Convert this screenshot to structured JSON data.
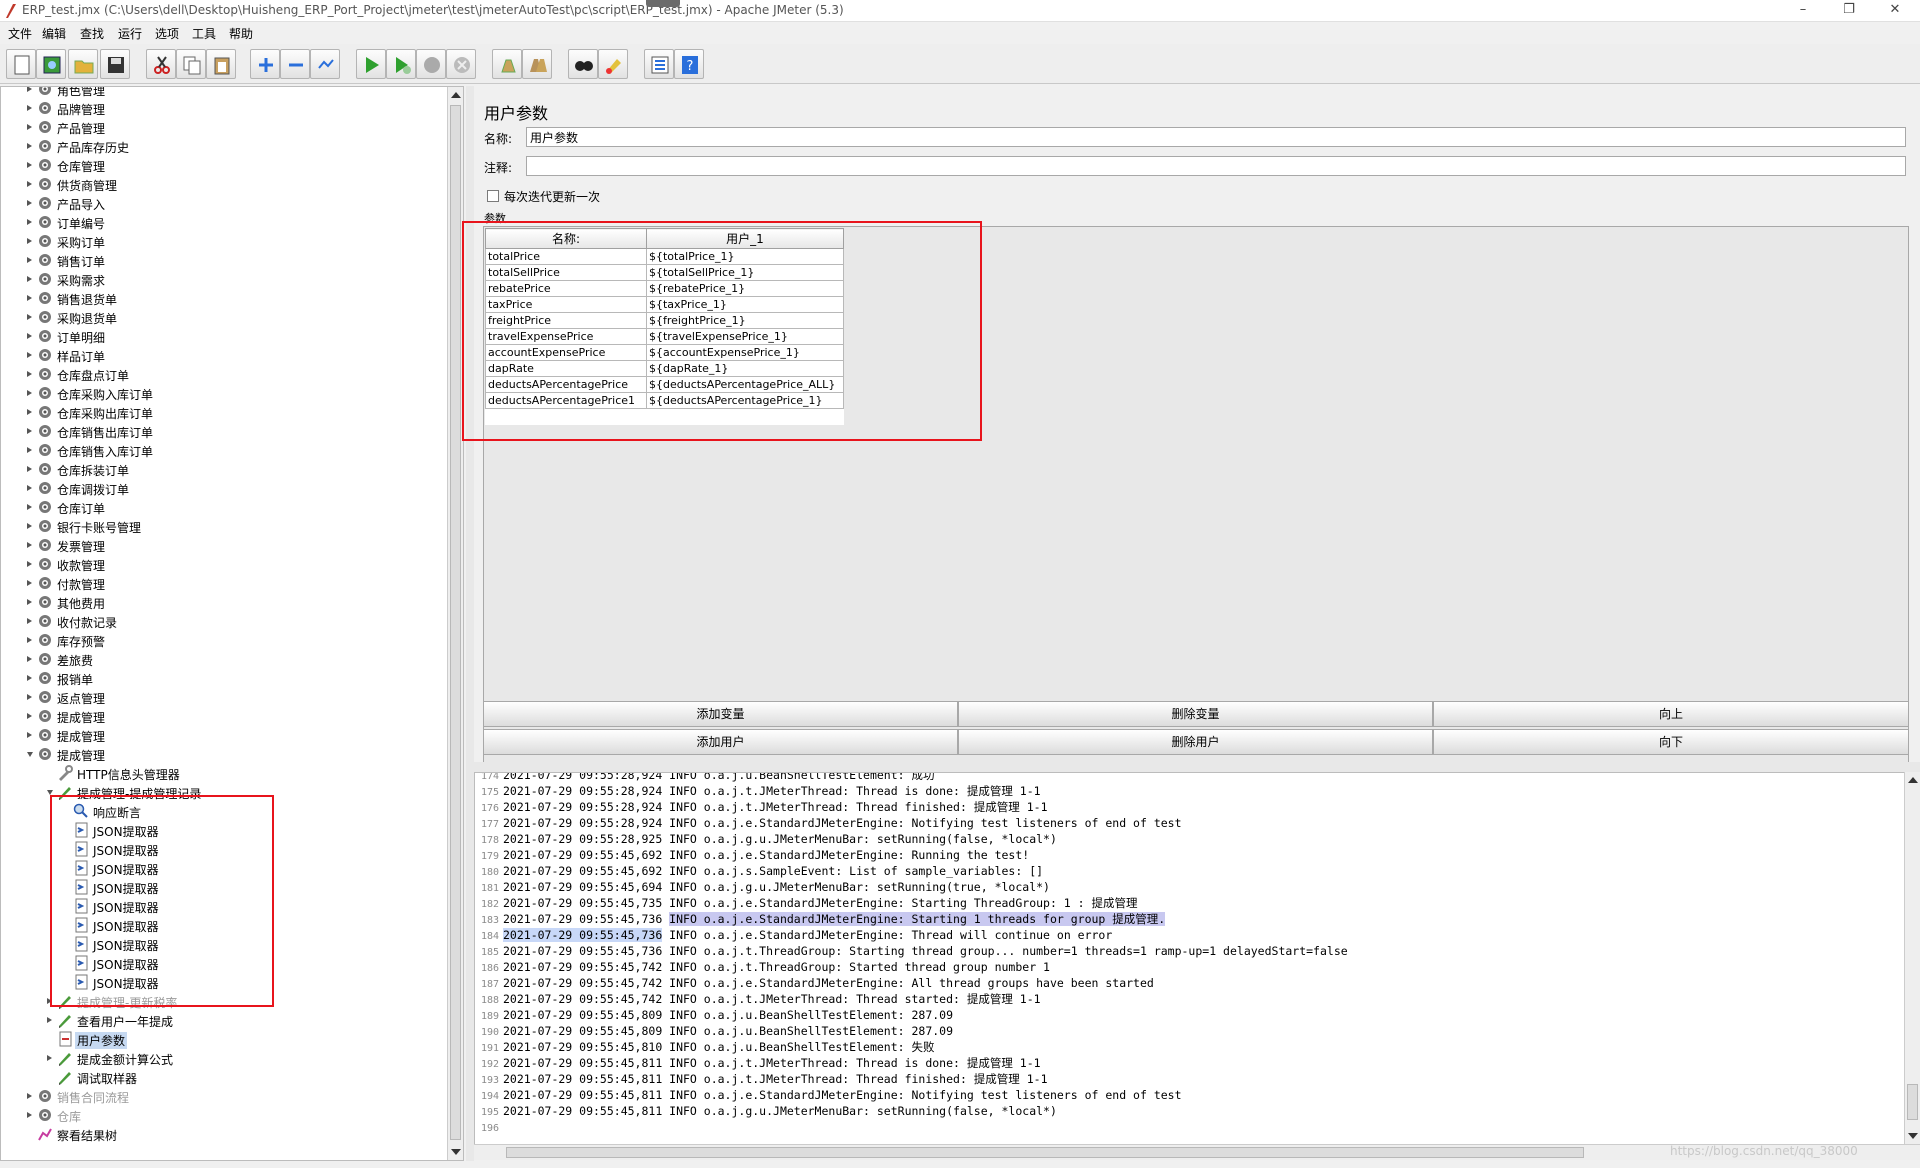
{
  "window": {
    "title": "ERP_test.jmx (C:\\Users\\dell\\Desktop\\Huisheng_ERP_Port_Project\\jmeter\\test\\jmeterAutoTest\\pc\\script\\ERP_test.jmx) - Apache JMeter (5.3)",
    "minimize": "–",
    "maximize": "❐",
    "close": "✕"
  },
  "menu": [
    "文件",
    "编辑",
    "查找",
    "运行",
    "选项",
    "工具",
    "帮助"
  ],
  "toolbar": [
    {
      "name": "new-icon"
    },
    {
      "name": "templates-icon"
    },
    {
      "name": "open-icon"
    },
    {
      "name": "save-icon"
    },
    {
      "name": "cut-icon"
    },
    {
      "name": "copy-icon"
    },
    {
      "name": "paste-icon"
    },
    {
      "name": "expand-icon"
    },
    {
      "name": "collapse-icon"
    },
    {
      "name": "toggle-icon"
    },
    {
      "name": "start-icon"
    },
    {
      "name": "start-no-pause-icon"
    },
    {
      "name": "stop-icon"
    },
    {
      "name": "shutdown-icon"
    },
    {
      "name": "clear-icon"
    },
    {
      "name": "clear-all-icon"
    },
    {
      "name": "search-icon"
    },
    {
      "name": "reset-search-icon"
    },
    {
      "name": "function-helper-icon"
    },
    {
      "name": "help-icon"
    }
  ],
  "tree": [
    {
      "label": "角色管理",
      "level": 1,
      "icon": "gear",
      "toggle": "closed"
    },
    {
      "label": "品牌管理",
      "level": 1,
      "icon": "gear",
      "toggle": "closed"
    },
    {
      "label": "产品管理",
      "level": 1,
      "icon": "gear",
      "toggle": "closed"
    },
    {
      "label": "产品库存历史",
      "level": 1,
      "icon": "gear",
      "toggle": "closed"
    },
    {
      "label": "仓库管理",
      "level": 1,
      "icon": "gear",
      "toggle": "closed"
    },
    {
      "label": "供货商管理",
      "level": 1,
      "icon": "gear",
      "toggle": "closed"
    },
    {
      "label": "产品导入",
      "level": 1,
      "icon": "gear",
      "toggle": "closed"
    },
    {
      "label": "订单编号",
      "level": 1,
      "icon": "gear",
      "toggle": "closed"
    },
    {
      "label": "采购订单",
      "level": 1,
      "icon": "gear",
      "toggle": "closed"
    },
    {
      "label": "销售订单",
      "level": 1,
      "icon": "gear",
      "toggle": "closed"
    },
    {
      "label": "采购需求",
      "level": 1,
      "icon": "gear",
      "toggle": "closed"
    },
    {
      "label": "销售退货单",
      "level": 1,
      "icon": "gear",
      "toggle": "closed"
    },
    {
      "label": "采购退货单",
      "level": 1,
      "icon": "gear",
      "toggle": "closed"
    },
    {
      "label": "订单明细",
      "level": 1,
      "icon": "gear",
      "toggle": "closed"
    },
    {
      "label": "样品订单",
      "level": 1,
      "icon": "gear",
      "toggle": "closed"
    },
    {
      "label": "仓库盘点订单",
      "level": 1,
      "icon": "gear",
      "toggle": "closed"
    },
    {
      "label": "仓库采购入库订单",
      "level": 1,
      "icon": "gear",
      "toggle": "closed"
    },
    {
      "label": "仓库采购出库订单",
      "level": 1,
      "icon": "gear",
      "toggle": "closed"
    },
    {
      "label": "仓库销售出库订单",
      "level": 1,
      "icon": "gear",
      "toggle": "closed"
    },
    {
      "label": "仓库销售入库订单",
      "level": 1,
      "icon": "gear",
      "toggle": "closed"
    },
    {
      "label": "仓库拆装订单",
      "level": 1,
      "icon": "gear",
      "toggle": "closed"
    },
    {
      "label": "仓库调拨订单",
      "level": 1,
      "icon": "gear",
      "toggle": "closed"
    },
    {
      "label": "仓库订单",
      "level": 1,
      "icon": "gear",
      "toggle": "closed"
    },
    {
      "label": "银行卡账号管理",
      "level": 1,
      "icon": "gear",
      "toggle": "closed"
    },
    {
      "label": "发票管理",
      "level": 1,
      "icon": "gear",
      "toggle": "closed"
    },
    {
      "label": "收款管理",
      "level": 1,
      "icon": "gear",
      "toggle": "closed"
    },
    {
      "label": "付款管理",
      "level": 1,
      "icon": "gear",
      "toggle": "closed"
    },
    {
      "label": "其他费用",
      "level": 1,
      "icon": "gear",
      "toggle": "closed"
    },
    {
      "label": "收付款记录",
      "level": 1,
      "icon": "gear",
      "toggle": "closed"
    },
    {
      "label": "库存预警",
      "level": 1,
      "icon": "gear",
      "toggle": "closed"
    },
    {
      "label": "差旅费",
      "level": 1,
      "icon": "gear",
      "toggle": "closed"
    },
    {
      "label": "报销单",
      "level": 1,
      "icon": "gear",
      "toggle": "closed"
    },
    {
      "label": "返点管理",
      "level": 1,
      "icon": "gear",
      "toggle": "closed"
    },
    {
      "label": "提成管理",
      "level": 1,
      "icon": "gear",
      "toggle": "closed"
    },
    {
      "label": "提成管理",
      "level": 1,
      "icon": "gear",
      "toggle": "closed"
    },
    {
      "label": "提成管理",
      "level": 1,
      "icon": "gear",
      "toggle": "open"
    },
    {
      "label": "HTTP信息头管理器",
      "level": 2,
      "icon": "wrench",
      "toggle": "none"
    },
    {
      "label": "提成管理-提成管理记录",
      "level": 2,
      "icon": "pen",
      "toggle": "open"
    },
    {
      "label": "响应断言",
      "level": 3,
      "icon": "magnifier",
      "toggle": "none"
    },
    {
      "label": "JSON提取器",
      "level": 3,
      "icon": "doc",
      "toggle": "none"
    },
    {
      "label": "JSON提取器",
      "level": 3,
      "icon": "doc",
      "toggle": "none"
    },
    {
      "label": "JSON提取器",
      "level": 3,
      "icon": "doc",
      "toggle": "none"
    },
    {
      "label": "JSON提取器",
      "level": 3,
      "icon": "doc",
      "toggle": "none"
    },
    {
      "label": "JSON提取器",
      "level": 3,
      "icon": "doc",
      "toggle": "none"
    },
    {
      "label": "JSON提取器",
      "level": 3,
      "icon": "doc",
      "toggle": "none"
    },
    {
      "label": "JSON提取器",
      "level": 3,
      "icon": "doc",
      "toggle": "none"
    },
    {
      "label": "JSON提取器",
      "level": 3,
      "icon": "doc",
      "toggle": "none"
    },
    {
      "label": "JSON提取器",
      "level": 3,
      "icon": "doc",
      "toggle": "none"
    },
    {
      "label": "提成管理-更新税率",
      "level": 2,
      "icon": "pen",
      "toggle": "closed",
      "dim": true
    },
    {
      "label": "查看用户一年提成",
      "level": 2,
      "icon": "pen",
      "toggle": "closed"
    },
    {
      "label": "用户参数",
      "level": 2,
      "icon": "params",
      "toggle": "none",
      "selected": true
    },
    {
      "label": "提成金额计算公式",
      "level": 2,
      "icon": "pen",
      "toggle": "closed"
    },
    {
      "label": "调试取样器",
      "level": 2,
      "icon": "pen",
      "toggle": "none"
    },
    {
      "label": "销售合同流程",
      "level": 1,
      "icon": "gear",
      "toggle": "closed",
      "dim": true
    },
    {
      "label": "仓库",
      "level": 1,
      "icon": "gear",
      "toggle": "closed",
      "dim": true
    },
    {
      "label": "察看结果树",
      "level": 1,
      "icon": "chart",
      "toggle": "none"
    }
  ],
  "editor": {
    "title": "用户参数",
    "name_label": "名称:",
    "name_value": "用户参数",
    "comment_label": "注释:",
    "comment_value": "",
    "checkbox_label": "每次迭代更新一次",
    "params_label": "参数",
    "table": {
      "headers": [
        "名称:",
        "用户_1"
      ],
      "rows": [
        [
          "totalPrice",
          "${totalPrice_1}"
        ],
        [
          "totalSellPrice",
          "${totalSellPrice_1}"
        ],
        [
          "rebatePrice",
          "${rebatePrice_1}"
        ],
        [
          "taxPrice",
          "${taxPrice_1}"
        ],
        [
          "freightPrice",
          "${freightPrice_1}"
        ],
        [
          "travelExpensePrice",
          "${travelExpensePrice_1}"
        ],
        [
          "accountExpensePrice",
          "${accountExpensePrice_1}"
        ],
        [
          "dapRate",
          "${dapRate_1}"
        ],
        [
          "deductsAPercentagePrice",
          "${deductsAPercentagePrice_ALL}"
        ],
        [
          "deductsAPercentagePrice1",
          "${deductsAPercentagePrice_1}"
        ]
      ]
    },
    "buttons": [
      [
        "添加变量",
        "删除变量",
        "向上"
      ],
      [
        "添加用户",
        "删除用户",
        "向下"
      ]
    ]
  },
  "log": [
    {
      "n": "174",
      "t": "2021-07-29 09:55:28,924 INFO o.a.j.u.BeanShellTestElement: 成功"
    },
    {
      "n": "175",
      "t": "2021-07-29 09:55:28,924 INFO o.a.j.t.JMeterThread: Thread is done: 提成管理 1-1"
    },
    {
      "n": "176",
      "t": "2021-07-29 09:55:28,924 INFO o.a.j.t.JMeterThread: Thread finished: 提成管理 1-1"
    },
    {
      "n": "177",
      "t": "2021-07-29 09:55:28,924 INFO o.a.j.e.StandardJMeterEngine: Notifying test listeners of end of test"
    },
    {
      "n": "178",
      "t": "2021-07-29 09:55:28,925 INFO o.a.j.g.u.JMeterMenuBar: setRunning(false, *local*)"
    },
    {
      "n": "179",
      "t": "2021-07-29 09:55:45,692 INFO o.a.j.e.StandardJMeterEngine: Running the test!"
    },
    {
      "n": "180",
      "t": "2021-07-29 09:55:45,692 INFO o.a.j.s.SampleEvent: List of sample_variables: []"
    },
    {
      "n": "181",
      "t": "2021-07-29 09:55:45,694 INFO o.a.j.g.u.JMeterMenuBar: setRunning(true, *local*)"
    },
    {
      "n": "182",
      "t": "2021-07-29 09:55:45,735 INFO o.a.j.e.StandardJMeterEngine: Starting ThreadGroup: 1 : 提成管理"
    },
    {
      "n": "183",
      "t": "2021-07-29 09:55:45,736 INFO o.a.j.e.StandardJMeterEngine: Starting 1 threads for group 提成管理.",
      "hl": "INFO o.a.j.e.StandardJMeterEngine: Starting 1 threads for group 提成管理."
    },
    {
      "n": "184",
      "t": "2021-07-29 09:55:45,736 INFO o.a.j.e.StandardJMeterEngine: Thread will continue on error",
      "hl2": "2021-07-29 09:55:45,736"
    },
    {
      "n": "185",
      "t": "2021-07-29 09:55:45,736 INFO o.a.j.t.ThreadGroup: Starting thread group... number=1 threads=1 ramp-up=1 delayedStart=false"
    },
    {
      "n": "186",
      "t": "2021-07-29 09:55:45,742 INFO o.a.j.t.ThreadGroup: Started thread group number 1"
    },
    {
      "n": "187",
      "t": "2021-07-29 09:55:45,742 INFO o.a.j.e.StandardJMeterEngine: All thread groups have been started"
    },
    {
      "n": "188",
      "t": "2021-07-29 09:55:45,742 INFO o.a.j.t.JMeterThread: Thread started: 提成管理 1-1"
    },
    {
      "n": "189",
      "t": "2021-07-29 09:55:45,809 INFO o.a.j.u.BeanShellTestElement: 287.09"
    },
    {
      "n": "190",
      "t": "2021-07-29 09:55:45,809 INFO o.a.j.u.BeanShellTestElement: 287.09"
    },
    {
      "n": "191",
      "t": "2021-07-29 09:55:45,810 INFO o.a.j.u.BeanShellTestElement: 失败"
    },
    {
      "n": "192",
      "t": "2021-07-29 09:55:45,811 INFO o.a.j.t.JMeterThread: Thread is done: 提成管理 1-1"
    },
    {
      "n": "193",
      "t": "2021-07-29 09:55:45,811 INFO o.a.j.t.JMeterThread: Thread finished: 提成管理 1-1"
    },
    {
      "n": "194",
      "t": "2021-07-29 09:55:45,811 INFO o.a.j.e.StandardJMeterEngine: Notifying test listeners of end of test"
    },
    {
      "n": "195",
      "t": "2021-07-29 09:55:45,811 INFO o.a.j.g.u.JMeterMenuBar: setRunning(false, *local*)"
    },
    {
      "n": "196",
      "t": ""
    }
  ],
  "watermark": "https://blog.csdn.net/qq_38000"
}
